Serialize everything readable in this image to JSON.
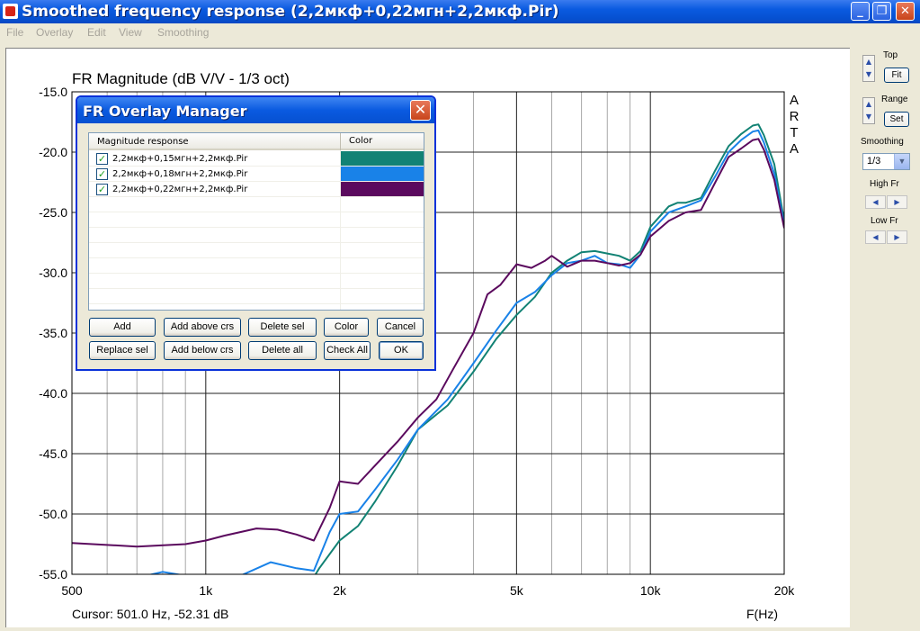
{
  "window": {
    "title": "Smoothed frequency response (2,2мкф+0,22мгн+2,2мкф.Pir)",
    "buttons": [
      "_",
      "❐",
      "✕"
    ]
  },
  "menu": [
    "File",
    "Overlay",
    "Edit",
    "View",
    "Smoothing"
  ],
  "side_panel": {
    "top_label": "Top",
    "fit_label": "Fit",
    "range_label": "Range",
    "set_label": "Set",
    "smoothing_label": "Smoothing",
    "smoothing_value": "1/3",
    "high_fr_label": "High Fr",
    "low_fr_label": "Low Fr"
  },
  "chart_data": {
    "type": "line",
    "title": "FR Magnitude (dB V/V - 1/3 oct)",
    "xlabel": "F(Hz)",
    "cursor": "Cursor: 501.0 Hz, -52.31 dB",
    "brand": "ARTA",
    "x_scale": "log",
    "xlim": [
      500,
      20000
    ],
    "ylim": [
      -55,
      -15
    ],
    "x_tick_labels": [
      "500",
      "1k",
      "2k",
      "5k",
      "10k",
      "20k"
    ],
    "y_tick_labels": [
      "-15.0",
      "-20.0",
      "-25.0",
      "-30.0",
      "-35.0",
      "-40.0",
      "-45.0",
      "-50.0",
      "-55.0"
    ],
    "grid": true,
    "series": [
      {
        "name": "2,2мкф+0,15мгн+2,2мкф.Pir",
        "color": "#128274",
        "points": [
          [
            1700,
            -56
          ],
          [
            1800,
            -54.5
          ],
          [
            2000,
            -52.2
          ],
          [
            2200,
            -51
          ],
          [
            2400,
            -49
          ],
          [
            2700,
            -46
          ],
          [
            3000,
            -43
          ],
          [
            3500,
            -41
          ],
          [
            4000,
            -38.2
          ],
          [
            4500,
            -35.5
          ],
          [
            5000,
            -33.5
          ],
          [
            5500,
            -32
          ],
          [
            6000,
            -30
          ],
          [
            6500,
            -29
          ],
          [
            7000,
            -28.3
          ],
          [
            7500,
            -28.2
          ],
          [
            8000,
            -28.4
          ],
          [
            8500,
            -28.6
          ],
          [
            9000,
            -29
          ],
          [
            9500,
            -28.2
          ],
          [
            10000,
            -26.2
          ],
          [
            11000,
            -24.5
          ],
          [
            11500,
            -24.2
          ],
          [
            12000,
            -24.2
          ],
          [
            13000,
            -23.8
          ],
          [
            14000,
            -21.5
          ],
          [
            15000,
            -19.5
          ],
          [
            16000,
            -18.5
          ],
          [
            17000,
            -17.8
          ],
          [
            17500,
            -17.7
          ],
          [
            18000,
            -18.6
          ],
          [
            19000,
            -21
          ],
          [
            20000,
            -25.7
          ]
        ]
      },
      {
        "name": "2,2мкф+0,18мгн+2,2мкф.Pir",
        "color": "#1982e8",
        "points": [
          [
            500,
            -56
          ],
          [
            700,
            -55.3
          ],
          [
            800,
            -54.8
          ],
          [
            1000,
            -55.4
          ],
          [
            1200,
            -55.1
          ],
          [
            1400,
            -54
          ],
          [
            1600,
            -54.5
          ],
          [
            1750,
            -54.7
          ],
          [
            1900,
            -51.5
          ],
          [
            2000,
            -50
          ],
          [
            2200,
            -49.8
          ],
          [
            2400,
            -48
          ],
          [
            2700,
            -45.5
          ],
          [
            3000,
            -43
          ],
          [
            3500,
            -40.5
          ],
          [
            4000,
            -37.5
          ],
          [
            4500,
            -34.8
          ],
          [
            5000,
            -32.5
          ],
          [
            5500,
            -31.6
          ],
          [
            6000,
            -30.2
          ],
          [
            6500,
            -29.2
          ],
          [
            7000,
            -29
          ],
          [
            7500,
            -28.6
          ],
          [
            8000,
            -29.2
          ],
          [
            8500,
            -29.3
          ],
          [
            9000,
            -29.6
          ],
          [
            9500,
            -28.5
          ],
          [
            10000,
            -26.6
          ],
          [
            11000,
            -25
          ],
          [
            12000,
            -24.5
          ],
          [
            13000,
            -24
          ],
          [
            14000,
            -22
          ],
          [
            15000,
            -20
          ],
          [
            16000,
            -19
          ],
          [
            17000,
            -18.3
          ],
          [
            17500,
            -18.2
          ],
          [
            18000,
            -19.2
          ],
          [
            19000,
            -21.8
          ],
          [
            20000,
            -26
          ]
        ]
      },
      {
        "name": "2,2мкф+0,22мгн+2,2мкф.Pir",
        "color": "#5b0a5e",
        "points": [
          [
            500,
            -52.4
          ],
          [
            700,
            -52.7
          ],
          [
            900,
            -52.5
          ],
          [
            1000,
            -52.2
          ],
          [
            1100,
            -51.8
          ],
          [
            1300,
            -51.2
          ],
          [
            1450,
            -51.3
          ],
          [
            1600,
            -51.7
          ],
          [
            1750,
            -52.2
          ],
          [
            1900,
            -49.5
          ],
          [
            2000,
            -47.3
          ],
          [
            2200,
            -47.5
          ],
          [
            2400,
            -46
          ],
          [
            2700,
            -44
          ],
          [
            3000,
            -42
          ],
          [
            3300,
            -40.5
          ],
          [
            3600,
            -38
          ],
          [
            4000,
            -35
          ],
          [
            4300,
            -31.8
          ],
          [
            4600,
            -31
          ],
          [
            5000,
            -29.3
          ],
          [
            5400,
            -29.6
          ],
          [
            5800,
            -29
          ],
          [
            6000,
            -28.6
          ],
          [
            6500,
            -29.5
          ],
          [
            7000,
            -29
          ],
          [
            7500,
            -29
          ],
          [
            8000,
            -29.2
          ],
          [
            8500,
            -29.4
          ],
          [
            9000,
            -29.2
          ],
          [
            9500,
            -28.5
          ],
          [
            10000,
            -27
          ],
          [
            11000,
            -25.7
          ],
          [
            12000,
            -25
          ],
          [
            13000,
            -24.8
          ],
          [
            14000,
            -22.5
          ],
          [
            15000,
            -20.4
          ],
          [
            16000,
            -19.7
          ],
          [
            17000,
            -19
          ],
          [
            17500,
            -18.9
          ],
          [
            18000,
            -19.8
          ],
          [
            19000,
            -22.3
          ],
          [
            20000,
            -26.3
          ]
        ]
      }
    ]
  },
  "dialog": {
    "title": "FR Overlay Manager",
    "col_name": "Magnitude response",
    "col_color": "Color",
    "rows": [
      {
        "name": "2,2мкф+0,15мгн+2,2мкф.Pir",
        "color": "#128274"
      },
      {
        "name": "2,2мкф+0,18мгн+2,2мкф.Pir",
        "color": "#1982e8"
      },
      {
        "name": "2,2мкф+0,22мгн+2,2мкф.Pir",
        "color": "#5b0a5e"
      }
    ],
    "buttons": {
      "add": "Add",
      "add_above": "Add above crs",
      "delete_sel": "Delete sel",
      "color": "Color",
      "cancel": "Cancel",
      "replace_sel": "Replace sel",
      "add_below": "Add below crs",
      "delete_all": "Delete all",
      "check_all": "Check All",
      "ok": "OK"
    }
  }
}
